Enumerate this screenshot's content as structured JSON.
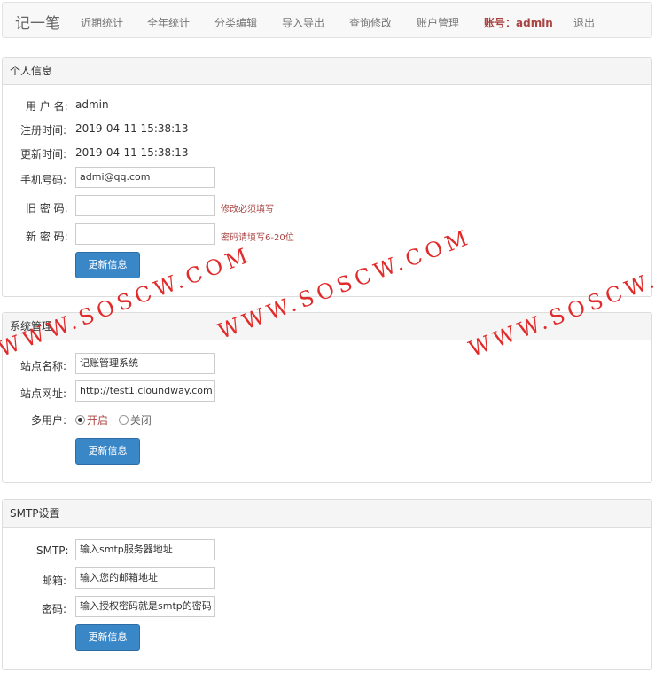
{
  "navbar": {
    "brand": "记一笔",
    "items": [
      "近期统计",
      "全年统计",
      "分类编辑",
      "导入导出",
      "查询修改",
      "账户管理"
    ],
    "account_label": "账号：admin",
    "logout": "退出"
  },
  "profile": {
    "heading": "个人信息",
    "username_label": "用 户 名:",
    "username": "admin",
    "registered_label": "注册时间:",
    "registered": "2019-04-11 15:38:13",
    "updated_label": "更新时间:",
    "updated": "2019-04-11 15:38:13",
    "phone_label": "手机号码:",
    "phone_value": "admi@qq.com",
    "old_pw_label": "旧 密 码:",
    "old_pw_hint": "修改必须填写",
    "new_pw_label": "新 密 码:",
    "new_pw_hint": "密码请填写6-20位",
    "submit": "更新信息"
  },
  "system": {
    "heading": "系统管理",
    "site_name_label": "站点名称:",
    "site_name_value": "记账管理系统",
    "site_url_label": "站点网址:",
    "site_url_value": "http://test1.cloundway.com",
    "multi_user_label": "多用户:",
    "multi_on": "开启",
    "multi_off": "关闭",
    "multi_selected": "开启",
    "submit": "更新信息"
  },
  "smtp": {
    "heading": "SMTP设置",
    "host_label": "SMTP:",
    "host_placeholder": "输入smtp服务器地址",
    "email_label": "邮箱:",
    "email_placeholder": "输入您的邮箱地址",
    "password_label": "密码:",
    "password_placeholder": "输入授权密码就是smtp的密码",
    "submit": "更新信息"
  },
  "watermark": {
    "text": "WWW.SOSCW.COM",
    "color": "#e02020"
  },
  "colors": {
    "primary": "#3a87c8",
    "danger": "#a94442"
  }
}
